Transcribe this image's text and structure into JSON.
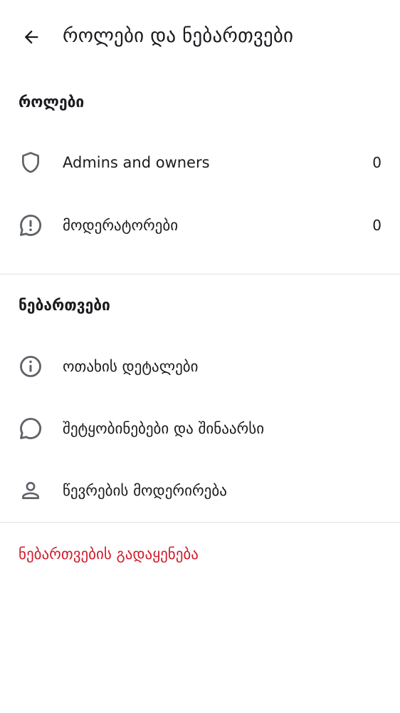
{
  "header": {
    "title": "როლები და ნებართვები",
    "back_icon": "arrow-left-icon"
  },
  "roles_section": {
    "title": "როლები",
    "items": [
      {
        "label": "Admins and owners",
        "count": "0",
        "icon": "shield-icon"
      },
      {
        "label": "მოდერატორები",
        "count": "0",
        "icon": "alert-bubble-icon"
      }
    ]
  },
  "permissions_section": {
    "title": "ნებართვები",
    "items": [
      {
        "label": "ოთახის დეტალები",
        "icon": "info-icon"
      },
      {
        "label": "შეტყობინებები და შინაარსი",
        "icon": "chat-bubble-icon"
      },
      {
        "label": "წევრების მოდერირება",
        "icon": "person-icon"
      }
    ]
  },
  "reset": {
    "label": "ნებართვების გადაყენება"
  },
  "colors": {
    "text": "#1b1b1f",
    "icon": "#5f6368",
    "divider": "#e3e3e6",
    "danger": "#d11a2a",
    "background": "#ffffff"
  }
}
